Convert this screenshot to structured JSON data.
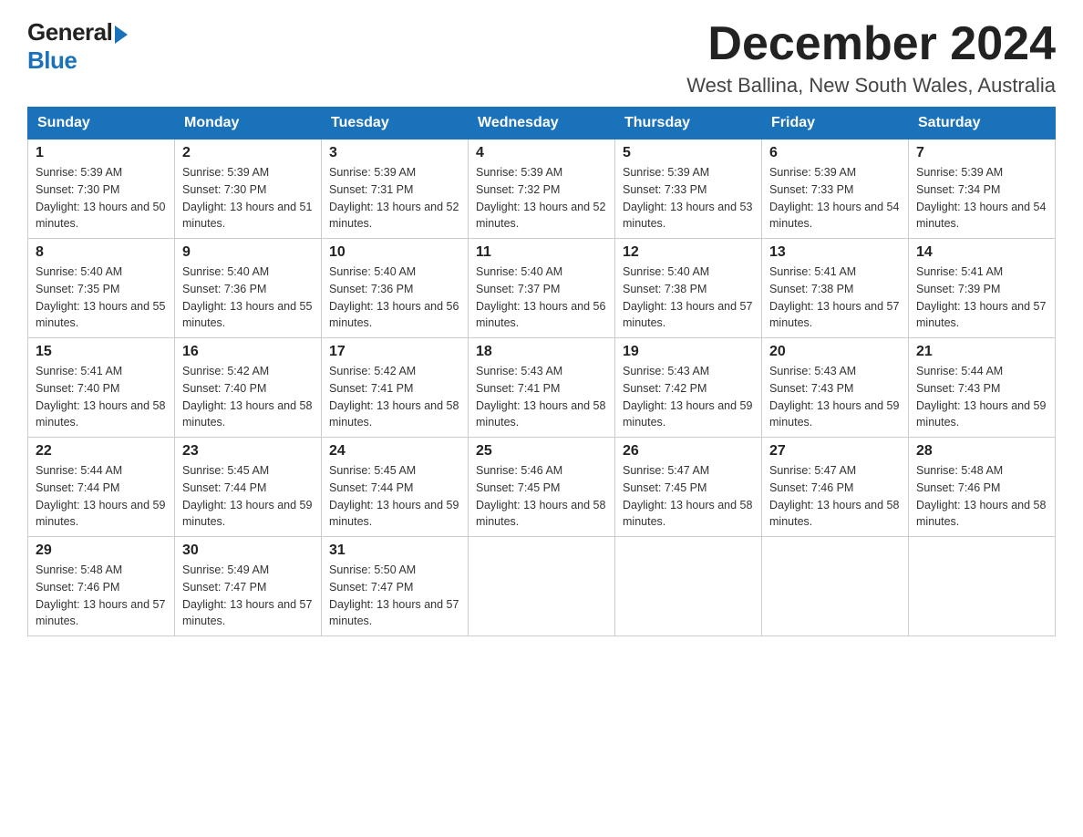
{
  "logo": {
    "general": "General",
    "blue": "Blue"
  },
  "title": "December 2024",
  "location": "West Ballina, New South Wales, Australia",
  "weekdays": [
    "Sunday",
    "Monday",
    "Tuesday",
    "Wednesday",
    "Thursday",
    "Friday",
    "Saturday"
  ],
  "weeks": [
    [
      {
        "day": "1",
        "sunrise": "Sunrise: 5:39 AM",
        "sunset": "Sunset: 7:30 PM",
        "daylight": "Daylight: 13 hours and 50 minutes."
      },
      {
        "day": "2",
        "sunrise": "Sunrise: 5:39 AM",
        "sunset": "Sunset: 7:30 PM",
        "daylight": "Daylight: 13 hours and 51 minutes."
      },
      {
        "day": "3",
        "sunrise": "Sunrise: 5:39 AM",
        "sunset": "Sunset: 7:31 PM",
        "daylight": "Daylight: 13 hours and 52 minutes."
      },
      {
        "day": "4",
        "sunrise": "Sunrise: 5:39 AM",
        "sunset": "Sunset: 7:32 PM",
        "daylight": "Daylight: 13 hours and 52 minutes."
      },
      {
        "day": "5",
        "sunrise": "Sunrise: 5:39 AM",
        "sunset": "Sunset: 7:33 PM",
        "daylight": "Daylight: 13 hours and 53 minutes."
      },
      {
        "day": "6",
        "sunrise": "Sunrise: 5:39 AM",
        "sunset": "Sunset: 7:33 PM",
        "daylight": "Daylight: 13 hours and 54 minutes."
      },
      {
        "day": "7",
        "sunrise": "Sunrise: 5:39 AM",
        "sunset": "Sunset: 7:34 PM",
        "daylight": "Daylight: 13 hours and 54 minutes."
      }
    ],
    [
      {
        "day": "8",
        "sunrise": "Sunrise: 5:40 AM",
        "sunset": "Sunset: 7:35 PM",
        "daylight": "Daylight: 13 hours and 55 minutes."
      },
      {
        "day": "9",
        "sunrise": "Sunrise: 5:40 AM",
        "sunset": "Sunset: 7:36 PM",
        "daylight": "Daylight: 13 hours and 55 minutes."
      },
      {
        "day": "10",
        "sunrise": "Sunrise: 5:40 AM",
        "sunset": "Sunset: 7:36 PM",
        "daylight": "Daylight: 13 hours and 56 minutes."
      },
      {
        "day": "11",
        "sunrise": "Sunrise: 5:40 AM",
        "sunset": "Sunset: 7:37 PM",
        "daylight": "Daylight: 13 hours and 56 minutes."
      },
      {
        "day": "12",
        "sunrise": "Sunrise: 5:40 AM",
        "sunset": "Sunset: 7:38 PM",
        "daylight": "Daylight: 13 hours and 57 minutes."
      },
      {
        "day": "13",
        "sunrise": "Sunrise: 5:41 AM",
        "sunset": "Sunset: 7:38 PM",
        "daylight": "Daylight: 13 hours and 57 minutes."
      },
      {
        "day": "14",
        "sunrise": "Sunrise: 5:41 AM",
        "sunset": "Sunset: 7:39 PM",
        "daylight": "Daylight: 13 hours and 57 minutes."
      }
    ],
    [
      {
        "day": "15",
        "sunrise": "Sunrise: 5:41 AM",
        "sunset": "Sunset: 7:40 PM",
        "daylight": "Daylight: 13 hours and 58 minutes."
      },
      {
        "day": "16",
        "sunrise": "Sunrise: 5:42 AM",
        "sunset": "Sunset: 7:40 PM",
        "daylight": "Daylight: 13 hours and 58 minutes."
      },
      {
        "day": "17",
        "sunrise": "Sunrise: 5:42 AM",
        "sunset": "Sunset: 7:41 PM",
        "daylight": "Daylight: 13 hours and 58 minutes."
      },
      {
        "day": "18",
        "sunrise": "Sunrise: 5:43 AM",
        "sunset": "Sunset: 7:41 PM",
        "daylight": "Daylight: 13 hours and 58 minutes."
      },
      {
        "day": "19",
        "sunrise": "Sunrise: 5:43 AM",
        "sunset": "Sunset: 7:42 PM",
        "daylight": "Daylight: 13 hours and 59 minutes."
      },
      {
        "day": "20",
        "sunrise": "Sunrise: 5:43 AM",
        "sunset": "Sunset: 7:43 PM",
        "daylight": "Daylight: 13 hours and 59 minutes."
      },
      {
        "day": "21",
        "sunrise": "Sunrise: 5:44 AM",
        "sunset": "Sunset: 7:43 PM",
        "daylight": "Daylight: 13 hours and 59 minutes."
      }
    ],
    [
      {
        "day": "22",
        "sunrise": "Sunrise: 5:44 AM",
        "sunset": "Sunset: 7:44 PM",
        "daylight": "Daylight: 13 hours and 59 minutes."
      },
      {
        "day": "23",
        "sunrise": "Sunrise: 5:45 AM",
        "sunset": "Sunset: 7:44 PM",
        "daylight": "Daylight: 13 hours and 59 minutes."
      },
      {
        "day": "24",
        "sunrise": "Sunrise: 5:45 AM",
        "sunset": "Sunset: 7:44 PM",
        "daylight": "Daylight: 13 hours and 59 minutes."
      },
      {
        "day": "25",
        "sunrise": "Sunrise: 5:46 AM",
        "sunset": "Sunset: 7:45 PM",
        "daylight": "Daylight: 13 hours and 58 minutes."
      },
      {
        "day": "26",
        "sunrise": "Sunrise: 5:47 AM",
        "sunset": "Sunset: 7:45 PM",
        "daylight": "Daylight: 13 hours and 58 minutes."
      },
      {
        "day": "27",
        "sunrise": "Sunrise: 5:47 AM",
        "sunset": "Sunset: 7:46 PM",
        "daylight": "Daylight: 13 hours and 58 minutes."
      },
      {
        "day": "28",
        "sunrise": "Sunrise: 5:48 AM",
        "sunset": "Sunset: 7:46 PM",
        "daylight": "Daylight: 13 hours and 58 minutes."
      }
    ],
    [
      {
        "day": "29",
        "sunrise": "Sunrise: 5:48 AM",
        "sunset": "Sunset: 7:46 PM",
        "daylight": "Daylight: 13 hours and 57 minutes."
      },
      {
        "day": "30",
        "sunrise": "Sunrise: 5:49 AM",
        "sunset": "Sunset: 7:47 PM",
        "daylight": "Daylight: 13 hours and 57 minutes."
      },
      {
        "day": "31",
        "sunrise": "Sunrise: 5:50 AM",
        "sunset": "Sunset: 7:47 PM",
        "daylight": "Daylight: 13 hours and 57 minutes."
      },
      {
        "day": "",
        "sunrise": "",
        "sunset": "",
        "daylight": ""
      },
      {
        "day": "",
        "sunrise": "",
        "sunset": "",
        "daylight": ""
      },
      {
        "day": "",
        "sunrise": "",
        "sunset": "",
        "daylight": ""
      },
      {
        "day": "",
        "sunrise": "",
        "sunset": "",
        "daylight": ""
      }
    ]
  ]
}
